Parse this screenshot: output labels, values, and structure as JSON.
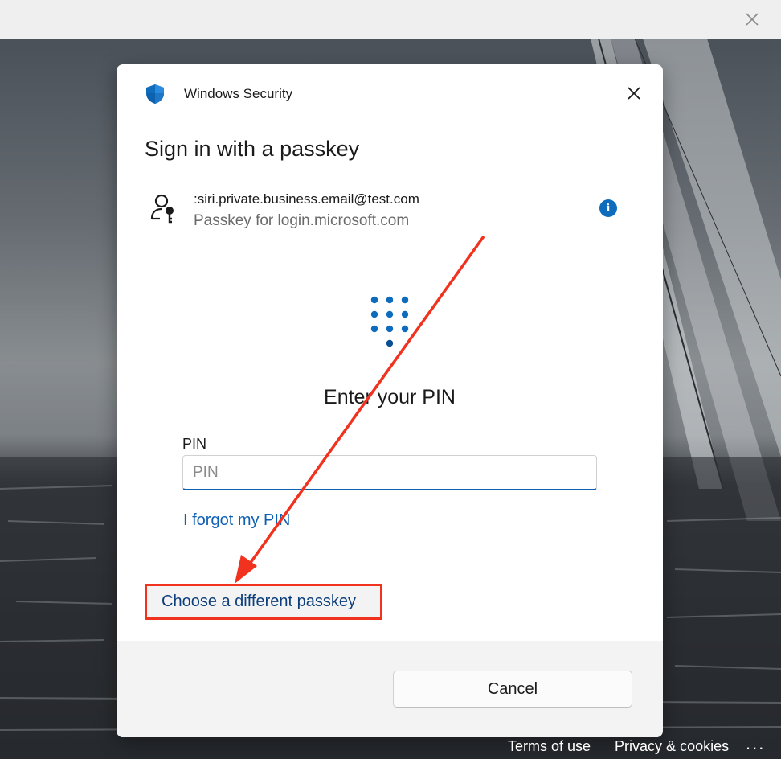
{
  "browser": {
    "close_icon": "close-icon"
  },
  "dialog": {
    "app_title": "Windows Security",
    "heading": "Sign in with a passkey",
    "account": {
      "email": ":siri.private.business.email@test.com",
      "subtitle": "Passkey for login.microsoft.com",
      "info_label": "i"
    },
    "prompt": "Enter your PIN",
    "pin": {
      "label": "PIN",
      "placeholder": "PIN",
      "value": ""
    },
    "forgot_link": "I forgot my PIN",
    "choose_button": "Choose a different passkey",
    "cancel_button": "Cancel"
  },
  "footer_links": {
    "terms": "Terms of use",
    "privacy": "Privacy & cookies",
    "more": "..."
  },
  "colors": {
    "accent": "#0f6cbd",
    "link": "#0f5fb3",
    "annotation": "#f0321e"
  }
}
